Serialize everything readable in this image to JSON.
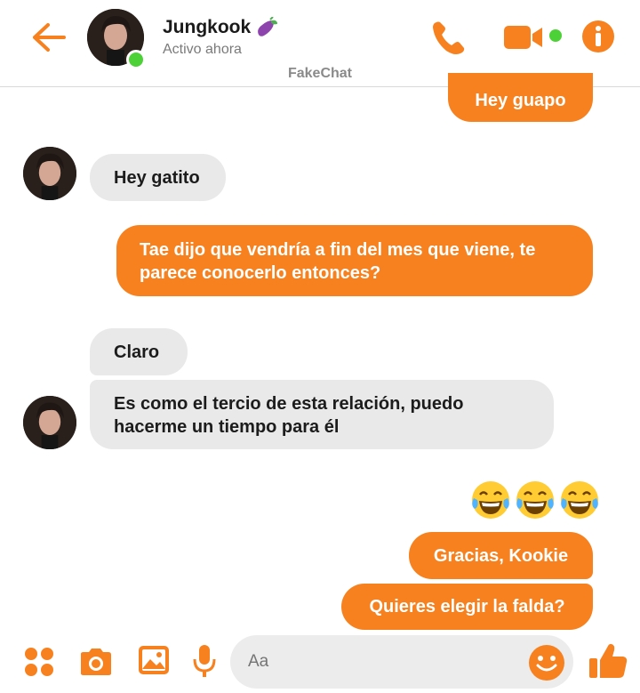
{
  "header": {
    "contact_name": "Jungkook",
    "status": "Activo ahora",
    "app_label": "FakeChat"
  },
  "icons": {
    "back": "arrow-left-icon",
    "call": "phone-icon",
    "video": "video-camera-icon",
    "info": "info-icon",
    "name_emoji": "eggplant-emoji",
    "apps": "grid-dots-icon",
    "camera": "camera-icon",
    "gallery": "image-icon",
    "mic": "microphone-icon",
    "emoji": "smiley-icon",
    "like": "thumbs-up-icon"
  },
  "colors": {
    "accent": "#f7811f",
    "incoming_bubble": "#e9e9e9",
    "online": "#4cd137"
  },
  "messages": [
    {
      "from": "me",
      "text": "Hey guapo"
    },
    {
      "from": "contact",
      "text": "Hey gatito"
    },
    {
      "from": "me",
      "text": "Tae dijo que vendría a fin del mes que viene, te parece conocerlo entonces?"
    },
    {
      "from": "contact",
      "text": "Claro"
    },
    {
      "from": "contact",
      "text": "Es como el tercio de esta relación, puedo hacerme un tiempo para él"
    },
    {
      "from": "me",
      "emoji": [
        "face-with-tears-of-joy",
        "face-with-tears-of-joy",
        "face-with-tears-of-joy"
      ]
    },
    {
      "from": "me",
      "text": "Gracias, Kookie"
    },
    {
      "from": "me",
      "text": "Quieres elegir la falda?"
    }
  ],
  "composer": {
    "placeholder": "Aa"
  }
}
